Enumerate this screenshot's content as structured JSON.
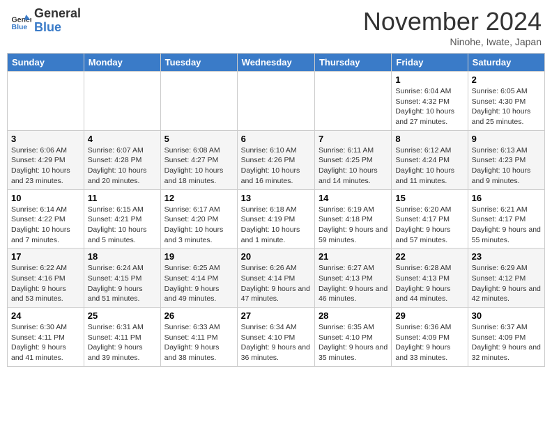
{
  "header": {
    "logo_line1": "General",
    "logo_line2": "Blue",
    "month_title": "November 2024",
    "location": "Ninohe, Iwate, Japan"
  },
  "weekdays": [
    "Sunday",
    "Monday",
    "Tuesday",
    "Wednesday",
    "Thursday",
    "Friday",
    "Saturday"
  ],
  "weeks": [
    [
      {
        "day": "",
        "info": ""
      },
      {
        "day": "",
        "info": ""
      },
      {
        "day": "",
        "info": ""
      },
      {
        "day": "",
        "info": ""
      },
      {
        "day": "",
        "info": ""
      },
      {
        "day": "1",
        "info": "Sunrise: 6:04 AM\nSunset: 4:32 PM\nDaylight: 10 hours and 27 minutes."
      },
      {
        "day": "2",
        "info": "Sunrise: 6:05 AM\nSunset: 4:30 PM\nDaylight: 10 hours and 25 minutes."
      }
    ],
    [
      {
        "day": "3",
        "info": "Sunrise: 6:06 AM\nSunset: 4:29 PM\nDaylight: 10 hours and 23 minutes."
      },
      {
        "day": "4",
        "info": "Sunrise: 6:07 AM\nSunset: 4:28 PM\nDaylight: 10 hours and 20 minutes."
      },
      {
        "day": "5",
        "info": "Sunrise: 6:08 AM\nSunset: 4:27 PM\nDaylight: 10 hours and 18 minutes."
      },
      {
        "day": "6",
        "info": "Sunrise: 6:10 AM\nSunset: 4:26 PM\nDaylight: 10 hours and 16 minutes."
      },
      {
        "day": "7",
        "info": "Sunrise: 6:11 AM\nSunset: 4:25 PM\nDaylight: 10 hours and 14 minutes."
      },
      {
        "day": "8",
        "info": "Sunrise: 6:12 AM\nSunset: 4:24 PM\nDaylight: 10 hours and 11 minutes."
      },
      {
        "day": "9",
        "info": "Sunrise: 6:13 AM\nSunset: 4:23 PM\nDaylight: 10 hours and 9 minutes."
      }
    ],
    [
      {
        "day": "10",
        "info": "Sunrise: 6:14 AM\nSunset: 4:22 PM\nDaylight: 10 hours and 7 minutes."
      },
      {
        "day": "11",
        "info": "Sunrise: 6:15 AM\nSunset: 4:21 PM\nDaylight: 10 hours and 5 minutes."
      },
      {
        "day": "12",
        "info": "Sunrise: 6:17 AM\nSunset: 4:20 PM\nDaylight: 10 hours and 3 minutes."
      },
      {
        "day": "13",
        "info": "Sunrise: 6:18 AM\nSunset: 4:19 PM\nDaylight: 10 hours and 1 minute."
      },
      {
        "day": "14",
        "info": "Sunrise: 6:19 AM\nSunset: 4:18 PM\nDaylight: 9 hours and 59 minutes."
      },
      {
        "day": "15",
        "info": "Sunrise: 6:20 AM\nSunset: 4:17 PM\nDaylight: 9 hours and 57 minutes."
      },
      {
        "day": "16",
        "info": "Sunrise: 6:21 AM\nSunset: 4:17 PM\nDaylight: 9 hours and 55 minutes."
      }
    ],
    [
      {
        "day": "17",
        "info": "Sunrise: 6:22 AM\nSunset: 4:16 PM\nDaylight: 9 hours and 53 minutes."
      },
      {
        "day": "18",
        "info": "Sunrise: 6:24 AM\nSunset: 4:15 PM\nDaylight: 9 hours and 51 minutes."
      },
      {
        "day": "19",
        "info": "Sunrise: 6:25 AM\nSunset: 4:14 PM\nDaylight: 9 hours and 49 minutes."
      },
      {
        "day": "20",
        "info": "Sunrise: 6:26 AM\nSunset: 4:14 PM\nDaylight: 9 hours and 47 minutes."
      },
      {
        "day": "21",
        "info": "Sunrise: 6:27 AM\nSunset: 4:13 PM\nDaylight: 9 hours and 46 minutes."
      },
      {
        "day": "22",
        "info": "Sunrise: 6:28 AM\nSunset: 4:13 PM\nDaylight: 9 hours and 44 minutes."
      },
      {
        "day": "23",
        "info": "Sunrise: 6:29 AM\nSunset: 4:12 PM\nDaylight: 9 hours and 42 minutes."
      }
    ],
    [
      {
        "day": "24",
        "info": "Sunrise: 6:30 AM\nSunset: 4:11 PM\nDaylight: 9 hours and 41 minutes."
      },
      {
        "day": "25",
        "info": "Sunrise: 6:31 AM\nSunset: 4:11 PM\nDaylight: 9 hours and 39 minutes."
      },
      {
        "day": "26",
        "info": "Sunrise: 6:33 AM\nSunset: 4:11 PM\nDaylight: 9 hours and 38 minutes."
      },
      {
        "day": "27",
        "info": "Sunrise: 6:34 AM\nSunset: 4:10 PM\nDaylight: 9 hours and 36 minutes."
      },
      {
        "day": "28",
        "info": "Sunrise: 6:35 AM\nSunset: 4:10 PM\nDaylight: 9 hours and 35 minutes."
      },
      {
        "day": "29",
        "info": "Sunrise: 6:36 AM\nSunset: 4:09 PM\nDaylight: 9 hours and 33 minutes."
      },
      {
        "day": "30",
        "info": "Sunrise: 6:37 AM\nSunset: 4:09 PM\nDaylight: 9 hours and 32 minutes."
      }
    ]
  ]
}
